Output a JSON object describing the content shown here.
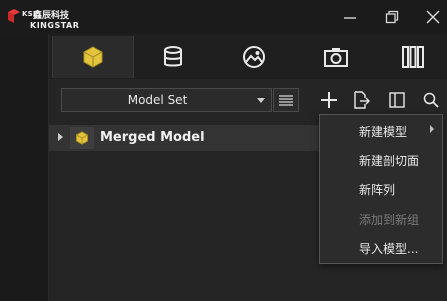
{
  "brand": {
    "small": "KSI",
    "cn": "鑫辰科技",
    "en": "KINGSTAR"
  },
  "window_controls": [
    "minimize-icon",
    "restore-icon",
    "close-icon"
  ],
  "tabs": [
    {
      "icon": "cube-icon",
      "active": true
    },
    {
      "icon": "database-icon",
      "active": false
    },
    {
      "icon": "image-icon",
      "active": false
    },
    {
      "icon": "camera-icon",
      "active": false
    },
    {
      "icon": "columns-icon",
      "active": false
    }
  ],
  "toolbar": {
    "model_select_value": "Model Set",
    "icons": [
      "list-icon",
      "add-icon",
      "export-icon",
      "panel-icon",
      "search-icon"
    ]
  },
  "tree": {
    "items": [
      {
        "label": "Merged Model",
        "icon": "cube-icon",
        "selected": true
      }
    ]
  },
  "context_menu": {
    "items": [
      {
        "label": "新建模型",
        "has_submenu": true,
        "enabled": true
      },
      {
        "label": "新建剖切面",
        "has_submenu": false,
        "enabled": true
      },
      {
        "label": "新阵列",
        "has_submenu": false,
        "enabled": true
      },
      {
        "label": "添加到新组",
        "has_submenu": false,
        "enabled": false
      },
      {
        "label": "导入模型...",
        "has_submenu": false,
        "enabled": true
      }
    ]
  },
  "colors": {
    "accent_cube": "#e3c43c",
    "background": "#1c1c1c",
    "panel": "#252525",
    "menu_bg": "#2c2c2c"
  }
}
